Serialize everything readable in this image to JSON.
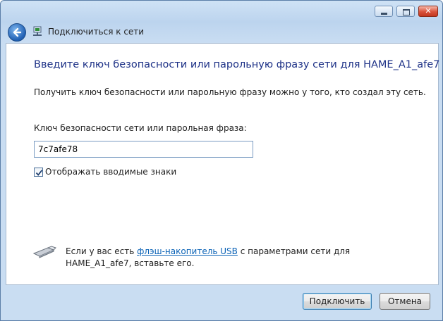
{
  "window": {
    "title": "Подключиться к сети",
    "controls": {
      "minimize": "minimize",
      "maximize": "maximize",
      "close": "✕"
    }
  },
  "main": {
    "heading": "Введите ключ безопасности или парольную фразу сети для HAME_A1_afe7",
    "description": "Получить ключ безопасности или парольную фразу можно у того, кто создал эту сеть.",
    "key_label": "Ключ безопасности сети или парольная фраза:",
    "key_value": "7c7afe78",
    "show_chars_label": "Отображать вводимые знаки",
    "show_chars_checked": true,
    "usb": {
      "text_before": "Если у вас есть ",
      "link": "флэш-накопитель USB",
      "text_after": " с параметрами сети для HAME_A1_afe7, вставьте его."
    }
  },
  "footer": {
    "connect_label": "Подключить",
    "cancel_label": "Отмена"
  },
  "colors": {
    "heading": "#1e3287",
    "link": "#0a62b6",
    "frame": "#bcd4ee"
  }
}
